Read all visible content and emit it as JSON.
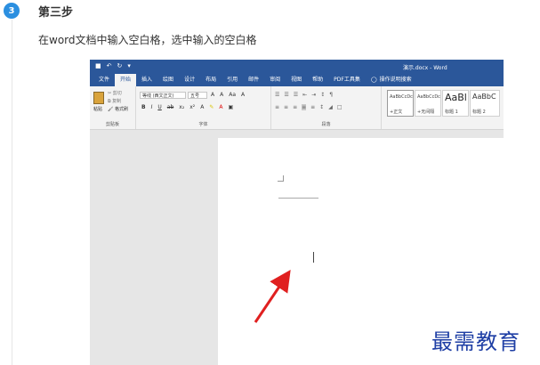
{
  "step": {
    "number": "3",
    "title": "第三步",
    "description": "在word文档中输入空白格，选中输入的空白格"
  },
  "word": {
    "title": "演示.docx - Word",
    "tabs": [
      {
        "label": "文件"
      },
      {
        "label": "开始"
      },
      {
        "label": "插入"
      },
      {
        "label": "绘图"
      },
      {
        "label": "设计"
      },
      {
        "label": "布局"
      },
      {
        "label": "引用"
      },
      {
        "label": "邮件"
      },
      {
        "label": "审阅"
      },
      {
        "label": "视图"
      },
      {
        "label": "帮助"
      },
      {
        "label": "PDF工具集"
      }
    ],
    "tell_me": "操作说明搜索",
    "clipboard": {
      "paste": "粘贴",
      "cut": "剪切",
      "copy": "复制",
      "format_painter": "格式刷",
      "group": "剪贴板"
    },
    "font": {
      "name": "等线 (西文正文)",
      "size": "五号",
      "group": "字体"
    },
    "paragraph": {
      "group": "段落"
    },
    "styles": [
      {
        "sample": "AaBbCcDc",
        "name": "+正文"
      },
      {
        "sample": "AaBbCcDc",
        "name": "+无间隔"
      },
      {
        "sample": "AaBl",
        "name": "标题 1"
      },
      {
        "sample": "AaBbC",
        "name": "标题 2"
      }
    ]
  },
  "watermark": "最需教育",
  "colors": {
    "accent": "#2b579a",
    "badge": "#2b8fe0",
    "arrow": "#e02020"
  }
}
